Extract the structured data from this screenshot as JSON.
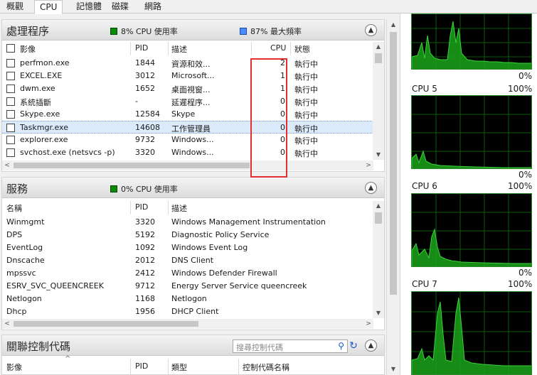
{
  "tabs": [
    {
      "label": "概觀",
      "active": false
    },
    {
      "label": "CPU",
      "active": true
    },
    {
      "label": "記憶體",
      "active": false
    },
    {
      "label": "磁碟",
      "active": false
    },
    {
      "label": "網路",
      "active": false
    }
  ],
  "processes": {
    "title": "處理程序",
    "cpu_usage": "8% CPU 使用率",
    "max_freq": "87% 最大頻率",
    "columns": {
      "image": "影像",
      "pid": "PID",
      "desc": "描述",
      "cpu": "CPU",
      "status": "狀態"
    },
    "rows": [
      {
        "image": "perfmon.exe",
        "pid": "1844",
        "desc": "資源和效...",
        "cpu": "2",
        "status": "執行中"
      },
      {
        "image": "EXCEL.EXE",
        "pid": "3012",
        "desc": "Microsoft...",
        "cpu": "1",
        "status": "執行中"
      },
      {
        "image": "dwm.exe",
        "pid": "1652",
        "desc": "桌面視窗...",
        "cpu": "1",
        "status": "執行中"
      },
      {
        "image": "系統插斷",
        "pid": "-",
        "desc": "延遲程序...",
        "cpu": "0",
        "status": "執行中"
      },
      {
        "image": "Skype.exe",
        "pid": "12584",
        "desc": "Skype",
        "cpu": "0",
        "status": "執行中"
      },
      {
        "image": "Taskmgr.exe",
        "pid": "14608",
        "desc": "工作管理員",
        "cpu": "0",
        "status": "執行中"
      },
      {
        "image": "explorer.exe",
        "pid": "9732",
        "desc": "Windows...",
        "cpu": "0",
        "status": "執行中"
      },
      {
        "image": "svchost.exe (netsvcs -p)",
        "pid": "3320",
        "desc": "Windows...",
        "cpu": "0",
        "status": "執行中"
      }
    ]
  },
  "services": {
    "title": "服務",
    "cpu_usage": "0% CPU 使用率",
    "columns": {
      "name": "名稱",
      "pid": "PID",
      "desc": "描述"
    },
    "rows": [
      {
        "name": "Winmgmt",
        "pid": "3320",
        "desc": "Windows Management Instrumentation"
      },
      {
        "name": "DPS",
        "pid": "5192",
        "desc": "Diagnostic Policy Service"
      },
      {
        "name": "EventLog",
        "pid": "1092",
        "desc": "Windows Event Log"
      },
      {
        "name": "Dnscache",
        "pid": "2012",
        "desc": "DNS Client"
      },
      {
        "name": "mpssvc",
        "pid": "2412",
        "desc": "Windows Defender Firewall"
      },
      {
        "name": "ESRV_SVC_QUEENCREEK",
        "pid": "9712",
        "desc": "Energy Server Service queencreek"
      },
      {
        "name": "Netlogon",
        "pid": "1168",
        "desc": "Netlogon"
      },
      {
        "name": "Dhcp",
        "pid": "1956",
        "desc": "DHCP Client"
      }
    ]
  },
  "handles": {
    "title": "關聯控制代碼",
    "search_placeholder": "搜尋控制代碼",
    "columns": {
      "image": "影像",
      "pid": "PID",
      "type": "類型",
      "name": "控制代碼名稱"
    }
  },
  "cpu_graphs": [
    {
      "label": "",
      "max": "",
      "min": "0%"
    },
    {
      "label": "CPU 5",
      "max": "100%",
      "min": "0%"
    },
    {
      "label": "CPU 6",
      "max": "100%",
      "min": "0%"
    },
    {
      "label": "CPU 7",
      "max": "100%",
      "min": ""
    }
  ],
  "colors": {
    "accent_red": "#e03030",
    "graph_green": "#0c8a0c",
    "selection": "#dcebfc"
  }
}
